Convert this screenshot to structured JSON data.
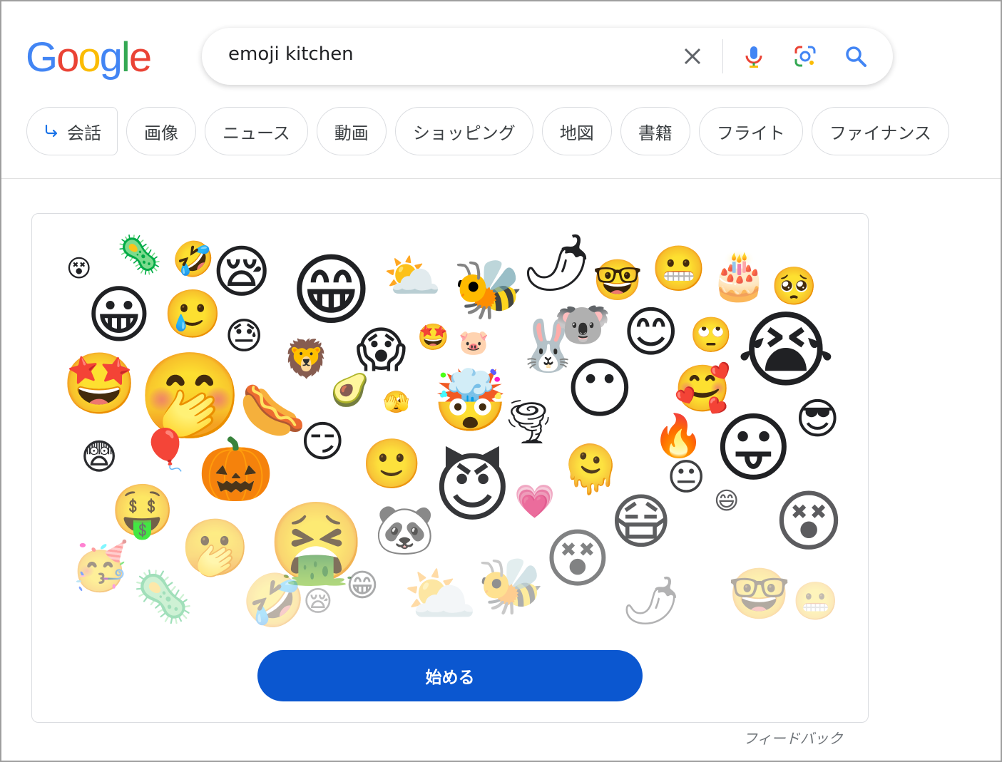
{
  "search": {
    "query": "emoji kitchen"
  },
  "logo": {
    "letters": [
      "G",
      "o",
      "o",
      "g",
      "l",
      "e"
    ],
    "colors": [
      "#4285f4",
      "#ea4335",
      "#fbbc05",
      "#4285f4",
      "#34a853",
      "#ea4335"
    ]
  },
  "chips": [
    {
      "label": "会話",
      "icon": "return-arrow-icon"
    },
    {
      "label": "画像"
    },
    {
      "label": "ニュース"
    },
    {
      "label": "動画"
    },
    {
      "label": "ショッピング"
    },
    {
      "label": "地図"
    },
    {
      "label": "書籍"
    },
    {
      "label": "フライト"
    },
    {
      "label": "ファイナンス"
    }
  ],
  "card": {
    "start_button": "始める",
    "emojis": [
      {
        "g": "😵",
        "n": "dizzy-face-emoji"
      },
      {
        "g": "🦠",
        "n": "microbe-emoji"
      },
      {
        "g": "🤣",
        "n": "rofl-emoji"
      },
      {
        "g": "😪",
        "n": "sleepy-face-emoji"
      },
      {
        "g": "😁",
        "n": "grinning-face-emoji"
      },
      {
        "g": "⛅",
        "n": "sun-cloud-emoji"
      },
      {
        "g": "🐝",
        "n": "bee-emoji"
      },
      {
        "g": "🌶",
        "n": "chili-pepper-emoji"
      },
      {
        "g": "🤓",
        "n": "nerd-face-emoji"
      },
      {
        "g": "😬",
        "n": "grimace-face-emoji"
      },
      {
        "g": "🎂",
        "n": "birthday-cake-emoji"
      },
      {
        "g": "🥺",
        "n": "pleading-face-emoji"
      },
      {
        "g": "😀",
        "n": "grin-face-emoji"
      },
      {
        "g": "🥲",
        "n": "tearful-smile-emoji"
      },
      {
        "g": "😓",
        "n": "downcast-sweat-emoji"
      },
      {
        "g": "😱",
        "n": "scream-face-emoji"
      },
      {
        "g": "🤩",
        "n": "flower-face-emoji"
      },
      {
        "g": "🐷",
        "n": "pig-emoji"
      },
      {
        "g": "🐰",
        "n": "rabbit-emoji"
      },
      {
        "g": "🐨",
        "n": "koala-emoji"
      },
      {
        "g": "😊",
        "n": "smiling-face-emoji"
      },
      {
        "g": "🙄",
        "n": "rolling-eyes-emoji"
      },
      {
        "g": "😭",
        "n": "crying-face-emoji"
      },
      {
        "g": "🤩",
        "n": "star-struck-emoji"
      },
      {
        "g": "🤭",
        "n": "hand-over-mouth-emoji"
      },
      {
        "g": "🦁",
        "n": "lion-emoji"
      },
      {
        "g": "🥑",
        "n": "avocado-emoji"
      },
      {
        "g": "🫣",
        "n": "peeking-face-emoji"
      },
      {
        "g": "🤯",
        "n": "exploding-head-emoji"
      },
      {
        "g": "🌪",
        "n": "tornado-emoji"
      },
      {
        "g": "😶",
        "n": "quiet-face-emoji"
      },
      {
        "g": "🥰",
        "n": "heart-face-emoji"
      },
      {
        "g": "🌭",
        "n": "hotdog-emoji"
      },
      {
        "g": "😨",
        "n": "fearful-face-emoji"
      },
      {
        "g": "🎈",
        "n": "balloon-emoji"
      },
      {
        "g": "🎃",
        "n": "jack-o-lantern-emoji"
      },
      {
        "g": "😏",
        "n": "smirk-face-emoji"
      },
      {
        "g": "🙂",
        "n": "slight-smile-emoji"
      },
      {
        "g": "😈",
        "n": "devil-emoji"
      },
      {
        "g": "🫠",
        "n": "melting-wand-emoji"
      },
      {
        "g": "🔥",
        "n": "fire-emoji"
      },
      {
        "g": "😛",
        "n": "tongue-face-emoji"
      },
      {
        "g": "😎",
        "n": "sunglasses-emoji"
      },
      {
        "g": "🤑",
        "n": "money-face-emoji"
      },
      {
        "g": "🤮",
        "n": "vomit-face-emoji"
      },
      {
        "g": "🐼",
        "n": "panda-emoji"
      },
      {
        "g": "💗",
        "n": "pink-heart-emoji"
      },
      {
        "g": "😷",
        "n": "mask-face-emoji"
      },
      {
        "g": "😐",
        "n": "neutral-face-emoji"
      },
      {
        "g": "😄",
        "n": "laughing-face-emoji"
      },
      {
        "g": "😵",
        "n": "x-eyes-emoji"
      },
      {
        "g": "🫢",
        "n": "gasp-face-emoji"
      },
      {
        "g": "🥳",
        "n": "party-face-emoji"
      }
    ]
  },
  "feedback": "フィードバック",
  "colors": {
    "button": "#0b57d0",
    "chip_border": "#dadce0"
  }
}
